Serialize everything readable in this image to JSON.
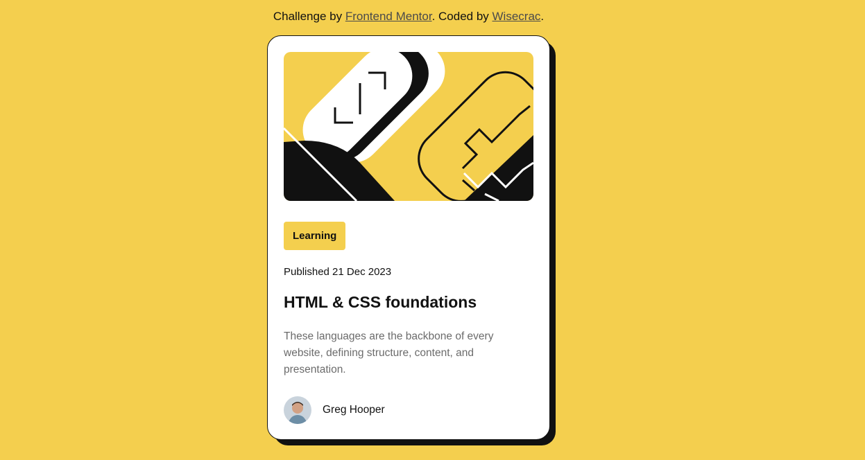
{
  "attribution": {
    "prefix": "Challenge by ",
    "challenge_link": "Frontend Mentor",
    "middle": ". Coded by ",
    "coder_link": "Wisecrac",
    "suffix": "."
  },
  "card": {
    "category": "Learning",
    "published": "Published 21 Dec 2023",
    "title": "HTML & CSS foundations",
    "description": "These languages are the backbone of every website, defining structure, content, and presentation.",
    "author": "Greg Hooper"
  },
  "colors": {
    "background": "#f4cf4e",
    "card": "#ffffff",
    "ink": "#111111",
    "muted": "#6b6b6b"
  }
}
